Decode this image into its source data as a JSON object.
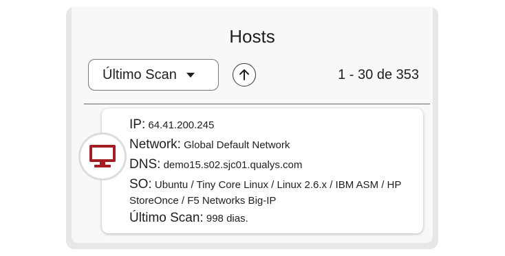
{
  "header": {
    "title": "Hosts"
  },
  "toolbar": {
    "sort_label": "Último Scan",
    "pagination": "1 - 30 de 353"
  },
  "host": {
    "icon": "desktop-monitor-icon",
    "icon_color": "#a31f24",
    "ip_label": "IP:",
    "ip_value": "64.41.200.245",
    "network_label": "Network:",
    "network_value": "Global Default Network",
    "dns_label": "DNS:",
    "dns_value": "demo15.s02.sjc01.qualys.com",
    "os_label": "SO:",
    "os_value": "Ubuntu / Tiny Core Linux / Linux 2.6.x / IBM ASM / HP StoreOnce / F5 Networks Big-IP",
    "last_scan_label": "Último Scan:",
    "last_scan_value": "998 dias."
  }
}
